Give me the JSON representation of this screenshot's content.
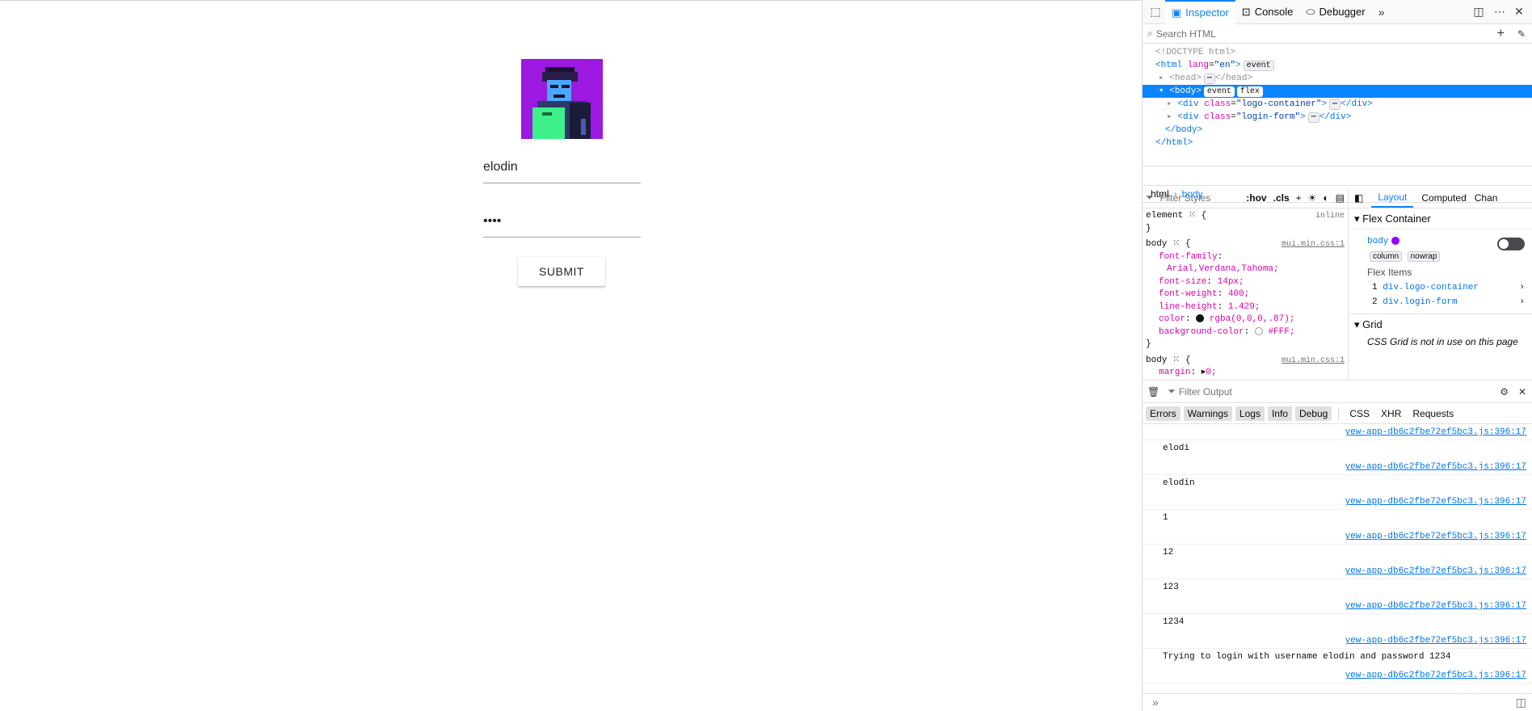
{
  "login": {
    "username": "elodin",
    "password_mask": "••••",
    "submit_label": "SUBMIT"
  },
  "devtools": {
    "tabs": {
      "inspector": "Inspector",
      "console": "Console",
      "debugger": "Debugger"
    },
    "search_placeholder": "Search HTML",
    "markup": {
      "doctype": "<!DOCTYPE html>",
      "html_open": "<html",
      "html_attr": "lang",
      "html_val": "\"en\"",
      "head": "<head>",
      "head_close": "</head>",
      "body": "<body>",
      "div_logo": "<div",
      "logo_attr": "class",
      "logo_val": "\"logo-container\"",
      "div_login": "<div",
      "login_val": "\"login-form\"",
      "div_close": "</div>",
      "body_close": "</body>",
      "html_close": "</html>",
      "badge_event": "event",
      "badge_flex": "flex",
      "ellipsis": "⋯"
    },
    "breadcrumbs": [
      "html",
      "body"
    ],
    "rules": {
      "filter_placeholder": "Filter Styles",
      "hov": ":hov",
      "cls": ".cls",
      "element_selector": "element",
      "element_source": "inline",
      "body_selector": "body",
      "body_source": "mui.min.css:1",
      "props": [
        {
          "name": "font-family",
          "value": "Arial,Verdana,Tahoma;"
        },
        {
          "name": "font-size",
          "value": "14px;"
        },
        {
          "name": "font-weight",
          "value": "400;"
        },
        {
          "name": "line-height",
          "value": "1.429;"
        },
        {
          "name": "color",
          "value": "rgba(0,0,0,.87);"
        },
        {
          "name": "background-color",
          "value": "#FFF;"
        }
      ],
      "body2_prop": "margin",
      "body2_val": "0;"
    },
    "layout": {
      "tabs": [
        "Layout",
        "Computed",
        "Chan"
      ],
      "flex_container": "Flex Container",
      "flex_el": "body",
      "flex_badges": [
        "column",
        "nowrap"
      ],
      "flex_items_title": "Flex Items",
      "flex_items": [
        {
          "index": "1",
          "label": "div.logo-container"
        },
        {
          "index": "2",
          "label": "div.login-form"
        }
      ],
      "grid_title": "Grid",
      "grid_note": "CSS Grid is not in use on this page"
    },
    "console": {
      "filter_placeholder": "Filter Output",
      "filters": [
        "Errors",
        "Warnings",
        "Logs",
        "Info",
        "Debug",
        "CSS",
        "XHR",
        "Requests"
      ],
      "source": "yew-app-db6c2fbe72ef5bc3.js:396:17",
      "messages": [
        "elodi",
        "elodin",
        "1",
        "12",
        "123",
        "1234",
        "Trying to login with username elodin and password 1234"
      ]
    },
    "colors": {
      "accent": "#0a84ff",
      "flex_dot": "#9400ff"
    }
  }
}
